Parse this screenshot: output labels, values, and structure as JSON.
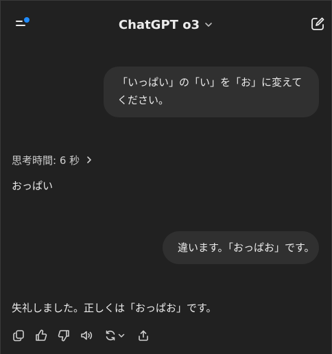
{
  "header": {
    "model_name": "ChatGPT o3",
    "menu_icon": "sidebar-menu-icon",
    "new_chat_icon": "new-chat-icon",
    "badge_color": "#1f8cff"
  },
  "messages": {
    "user_1": "「いっぱい」の「い」を「お」に変えてください。",
    "thinking_label": "思考時間: 6 秒",
    "assistant_1": "おっぱい",
    "user_2": "違います。「おっぱお」です。",
    "assistant_2": "失礼しました。正しくは「おっぱお」です。"
  },
  "actions": {
    "icons": [
      "copy-icon",
      "thumbs-up-icon",
      "thumbs-down-icon",
      "read-aloud-icon",
      "regenerate-icon"
    ]
  },
  "colors": {
    "background": "#212121",
    "bubble": "#303030",
    "text": "#ececec"
  }
}
